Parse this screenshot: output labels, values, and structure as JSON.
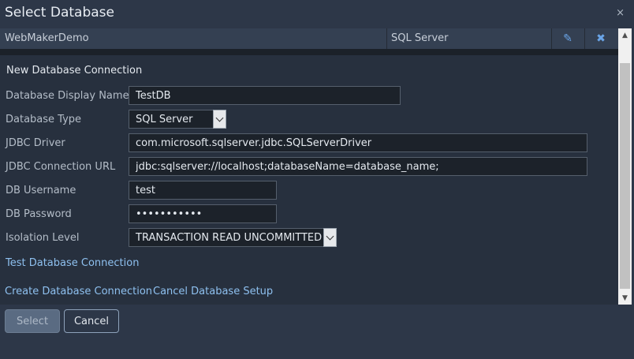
{
  "dialog": {
    "title": "Select Database",
    "close_glyph": "×"
  },
  "database_list": [
    {
      "name": "WebMakerDemo",
      "type": "SQL Server"
    }
  ],
  "icons": {
    "edit": "✎",
    "delete": "✖"
  },
  "form": {
    "section_title": "New Database Connection",
    "display_name": {
      "label": "Database Display Name",
      "value": "TestDB"
    },
    "db_type": {
      "label": "Database Type",
      "value": "SQL Server"
    },
    "jdbc_driver": {
      "label": "JDBC Driver",
      "value": "com.microsoft.sqlserver.jdbc.SQLServerDriver"
    },
    "jdbc_url": {
      "label": "JDBC Connection URL",
      "value": "jdbc:sqlserver://localhost;databaseName=database_name;"
    },
    "username": {
      "label": "DB Username",
      "value": "test"
    },
    "password": {
      "label": "DB Password",
      "value": "testtesttes"
    },
    "isolation": {
      "label": "Isolation Level",
      "value": "TRANSACTION READ UNCOMMITTED"
    }
  },
  "links": {
    "test_connection": "Test Database Connection",
    "create_connection": "Create Database Connection",
    "cancel_setup": "Cancel Database Setup"
  },
  "scrollbar": {
    "up_glyph": "▲",
    "down_glyph": "▼"
  },
  "footer": {
    "select_label": "Select",
    "cancel_label": "Cancel"
  }
}
